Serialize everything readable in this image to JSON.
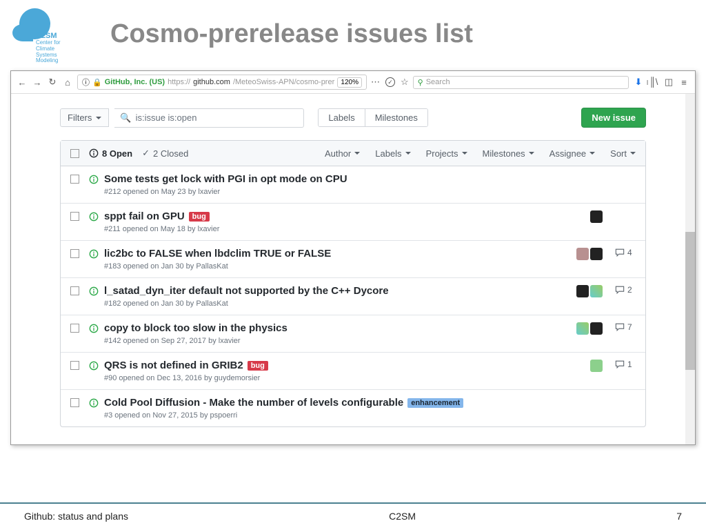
{
  "slide": {
    "title": "Cosmo-prerelease issues list",
    "logo_line1": "C2SM",
    "logo_line2": "Center for Climate\nSystems Modeling"
  },
  "browser": {
    "cert": "GitHub, Inc. (US)",
    "url_prefix": "https://",
    "url_host": "github.com",
    "url_path": "/MeteoSwiss-APN/cosmo-prer",
    "zoom": "120%",
    "search_placeholder": "Search"
  },
  "filterbar": {
    "filters": "Filters",
    "query": "is:issue is:open",
    "labels": "Labels",
    "milestones": "Milestones",
    "new_issue": "New issue"
  },
  "header": {
    "open_count": "8 Open",
    "closed_count": "2 Closed",
    "cols": {
      "author": "Author",
      "labels": "Labels",
      "projects": "Projects",
      "milestones": "Milestones",
      "assignee": "Assignee",
      "sort": "Sort"
    }
  },
  "issues": [
    {
      "title": "Some tests get lock with PGI in opt mode on CPU",
      "meta": "#212 opened on May 23 by lxavier",
      "labels": [],
      "assignees": [],
      "comments": null
    },
    {
      "title": "sppt fail on GPU",
      "meta": "#211 opened on May 18 by lxavier",
      "labels": [
        "bug"
      ],
      "assignees": [
        "av1"
      ],
      "comments": null
    },
    {
      "title": "lic2bc to FALSE when lbdclim TRUE or FALSE",
      "meta": "#183 opened on Jan 30 by PallasKat",
      "labels": [],
      "assignees": [
        "av2",
        "av1"
      ],
      "comments": 4
    },
    {
      "title": "l_satad_dyn_iter default not supported by the C++ Dycore",
      "meta": "#182 opened on Jan 30 by PallasKat",
      "labels": [],
      "assignees": [
        "av1",
        "av3"
      ],
      "comments": 2
    },
    {
      "title": "copy to block too slow in the physics",
      "meta": "#142 opened on Sep 27, 2017 by lxavier",
      "labels": [],
      "assignees": [
        "av3",
        "av1"
      ],
      "comments": 7
    },
    {
      "title": "QRS is not defined in GRIB2",
      "meta": "#90 opened on Dec 13, 2016 by guydemorsier",
      "labels": [
        "bug"
      ],
      "assignees": [
        "av4"
      ],
      "comments": 1
    },
    {
      "title": "Cold Pool Diffusion - Make the number of levels configurable",
      "meta": "#3 opened on Nov 27, 2015 by pspoerri",
      "labels": [
        "enhancement"
      ],
      "assignees": [],
      "comments": null
    }
  ],
  "footer": {
    "left": "Github: status and plans",
    "center": "C2SM",
    "right": "7"
  }
}
